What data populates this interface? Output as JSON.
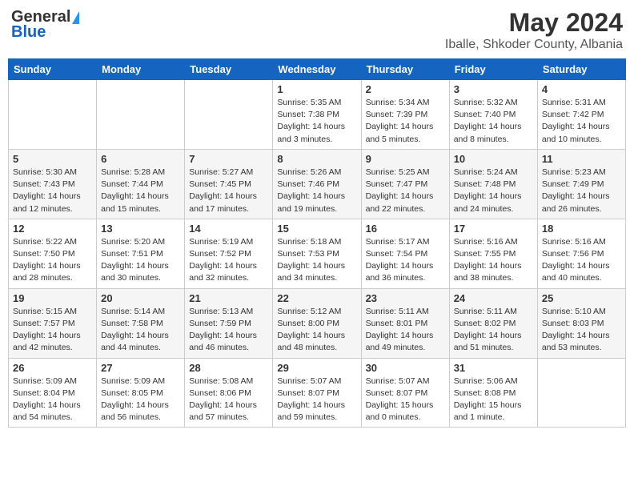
{
  "logo": {
    "general": "General",
    "blue": "Blue"
  },
  "title": "May 2024",
  "location": "Iballe, Shkoder County, Albania",
  "weekdays": [
    "Sunday",
    "Monday",
    "Tuesday",
    "Wednesday",
    "Thursday",
    "Friday",
    "Saturday"
  ],
  "weeks": [
    [
      {
        "day": "",
        "info": ""
      },
      {
        "day": "",
        "info": ""
      },
      {
        "day": "",
        "info": ""
      },
      {
        "day": "1",
        "info": "Sunrise: 5:35 AM\nSunset: 7:38 PM\nDaylight: 14 hours\nand 3 minutes."
      },
      {
        "day": "2",
        "info": "Sunrise: 5:34 AM\nSunset: 7:39 PM\nDaylight: 14 hours\nand 5 minutes."
      },
      {
        "day": "3",
        "info": "Sunrise: 5:32 AM\nSunset: 7:40 PM\nDaylight: 14 hours\nand 8 minutes."
      },
      {
        "day": "4",
        "info": "Sunrise: 5:31 AM\nSunset: 7:42 PM\nDaylight: 14 hours\nand 10 minutes."
      }
    ],
    [
      {
        "day": "5",
        "info": "Sunrise: 5:30 AM\nSunset: 7:43 PM\nDaylight: 14 hours\nand 12 minutes."
      },
      {
        "day": "6",
        "info": "Sunrise: 5:28 AM\nSunset: 7:44 PM\nDaylight: 14 hours\nand 15 minutes."
      },
      {
        "day": "7",
        "info": "Sunrise: 5:27 AM\nSunset: 7:45 PM\nDaylight: 14 hours\nand 17 minutes."
      },
      {
        "day": "8",
        "info": "Sunrise: 5:26 AM\nSunset: 7:46 PM\nDaylight: 14 hours\nand 19 minutes."
      },
      {
        "day": "9",
        "info": "Sunrise: 5:25 AM\nSunset: 7:47 PM\nDaylight: 14 hours\nand 22 minutes."
      },
      {
        "day": "10",
        "info": "Sunrise: 5:24 AM\nSunset: 7:48 PM\nDaylight: 14 hours\nand 24 minutes."
      },
      {
        "day": "11",
        "info": "Sunrise: 5:23 AM\nSunset: 7:49 PM\nDaylight: 14 hours\nand 26 minutes."
      }
    ],
    [
      {
        "day": "12",
        "info": "Sunrise: 5:22 AM\nSunset: 7:50 PM\nDaylight: 14 hours\nand 28 minutes."
      },
      {
        "day": "13",
        "info": "Sunrise: 5:20 AM\nSunset: 7:51 PM\nDaylight: 14 hours\nand 30 minutes."
      },
      {
        "day": "14",
        "info": "Sunrise: 5:19 AM\nSunset: 7:52 PM\nDaylight: 14 hours\nand 32 minutes."
      },
      {
        "day": "15",
        "info": "Sunrise: 5:18 AM\nSunset: 7:53 PM\nDaylight: 14 hours\nand 34 minutes."
      },
      {
        "day": "16",
        "info": "Sunrise: 5:17 AM\nSunset: 7:54 PM\nDaylight: 14 hours\nand 36 minutes."
      },
      {
        "day": "17",
        "info": "Sunrise: 5:16 AM\nSunset: 7:55 PM\nDaylight: 14 hours\nand 38 minutes."
      },
      {
        "day": "18",
        "info": "Sunrise: 5:16 AM\nSunset: 7:56 PM\nDaylight: 14 hours\nand 40 minutes."
      }
    ],
    [
      {
        "day": "19",
        "info": "Sunrise: 5:15 AM\nSunset: 7:57 PM\nDaylight: 14 hours\nand 42 minutes."
      },
      {
        "day": "20",
        "info": "Sunrise: 5:14 AM\nSunset: 7:58 PM\nDaylight: 14 hours\nand 44 minutes."
      },
      {
        "day": "21",
        "info": "Sunrise: 5:13 AM\nSunset: 7:59 PM\nDaylight: 14 hours\nand 46 minutes."
      },
      {
        "day": "22",
        "info": "Sunrise: 5:12 AM\nSunset: 8:00 PM\nDaylight: 14 hours\nand 48 minutes."
      },
      {
        "day": "23",
        "info": "Sunrise: 5:11 AM\nSunset: 8:01 PM\nDaylight: 14 hours\nand 49 minutes."
      },
      {
        "day": "24",
        "info": "Sunrise: 5:11 AM\nSunset: 8:02 PM\nDaylight: 14 hours\nand 51 minutes."
      },
      {
        "day": "25",
        "info": "Sunrise: 5:10 AM\nSunset: 8:03 PM\nDaylight: 14 hours\nand 53 minutes."
      }
    ],
    [
      {
        "day": "26",
        "info": "Sunrise: 5:09 AM\nSunset: 8:04 PM\nDaylight: 14 hours\nand 54 minutes."
      },
      {
        "day": "27",
        "info": "Sunrise: 5:09 AM\nSunset: 8:05 PM\nDaylight: 14 hours\nand 56 minutes."
      },
      {
        "day": "28",
        "info": "Sunrise: 5:08 AM\nSunset: 8:06 PM\nDaylight: 14 hours\nand 57 minutes."
      },
      {
        "day": "29",
        "info": "Sunrise: 5:07 AM\nSunset: 8:07 PM\nDaylight: 14 hours\nand 59 minutes."
      },
      {
        "day": "30",
        "info": "Sunrise: 5:07 AM\nSunset: 8:07 PM\nDaylight: 15 hours\nand 0 minutes."
      },
      {
        "day": "31",
        "info": "Sunrise: 5:06 AM\nSunset: 8:08 PM\nDaylight: 15 hours\nand 1 minute."
      },
      {
        "day": "",
        "info": ""
      }
    ]
  ]
}
